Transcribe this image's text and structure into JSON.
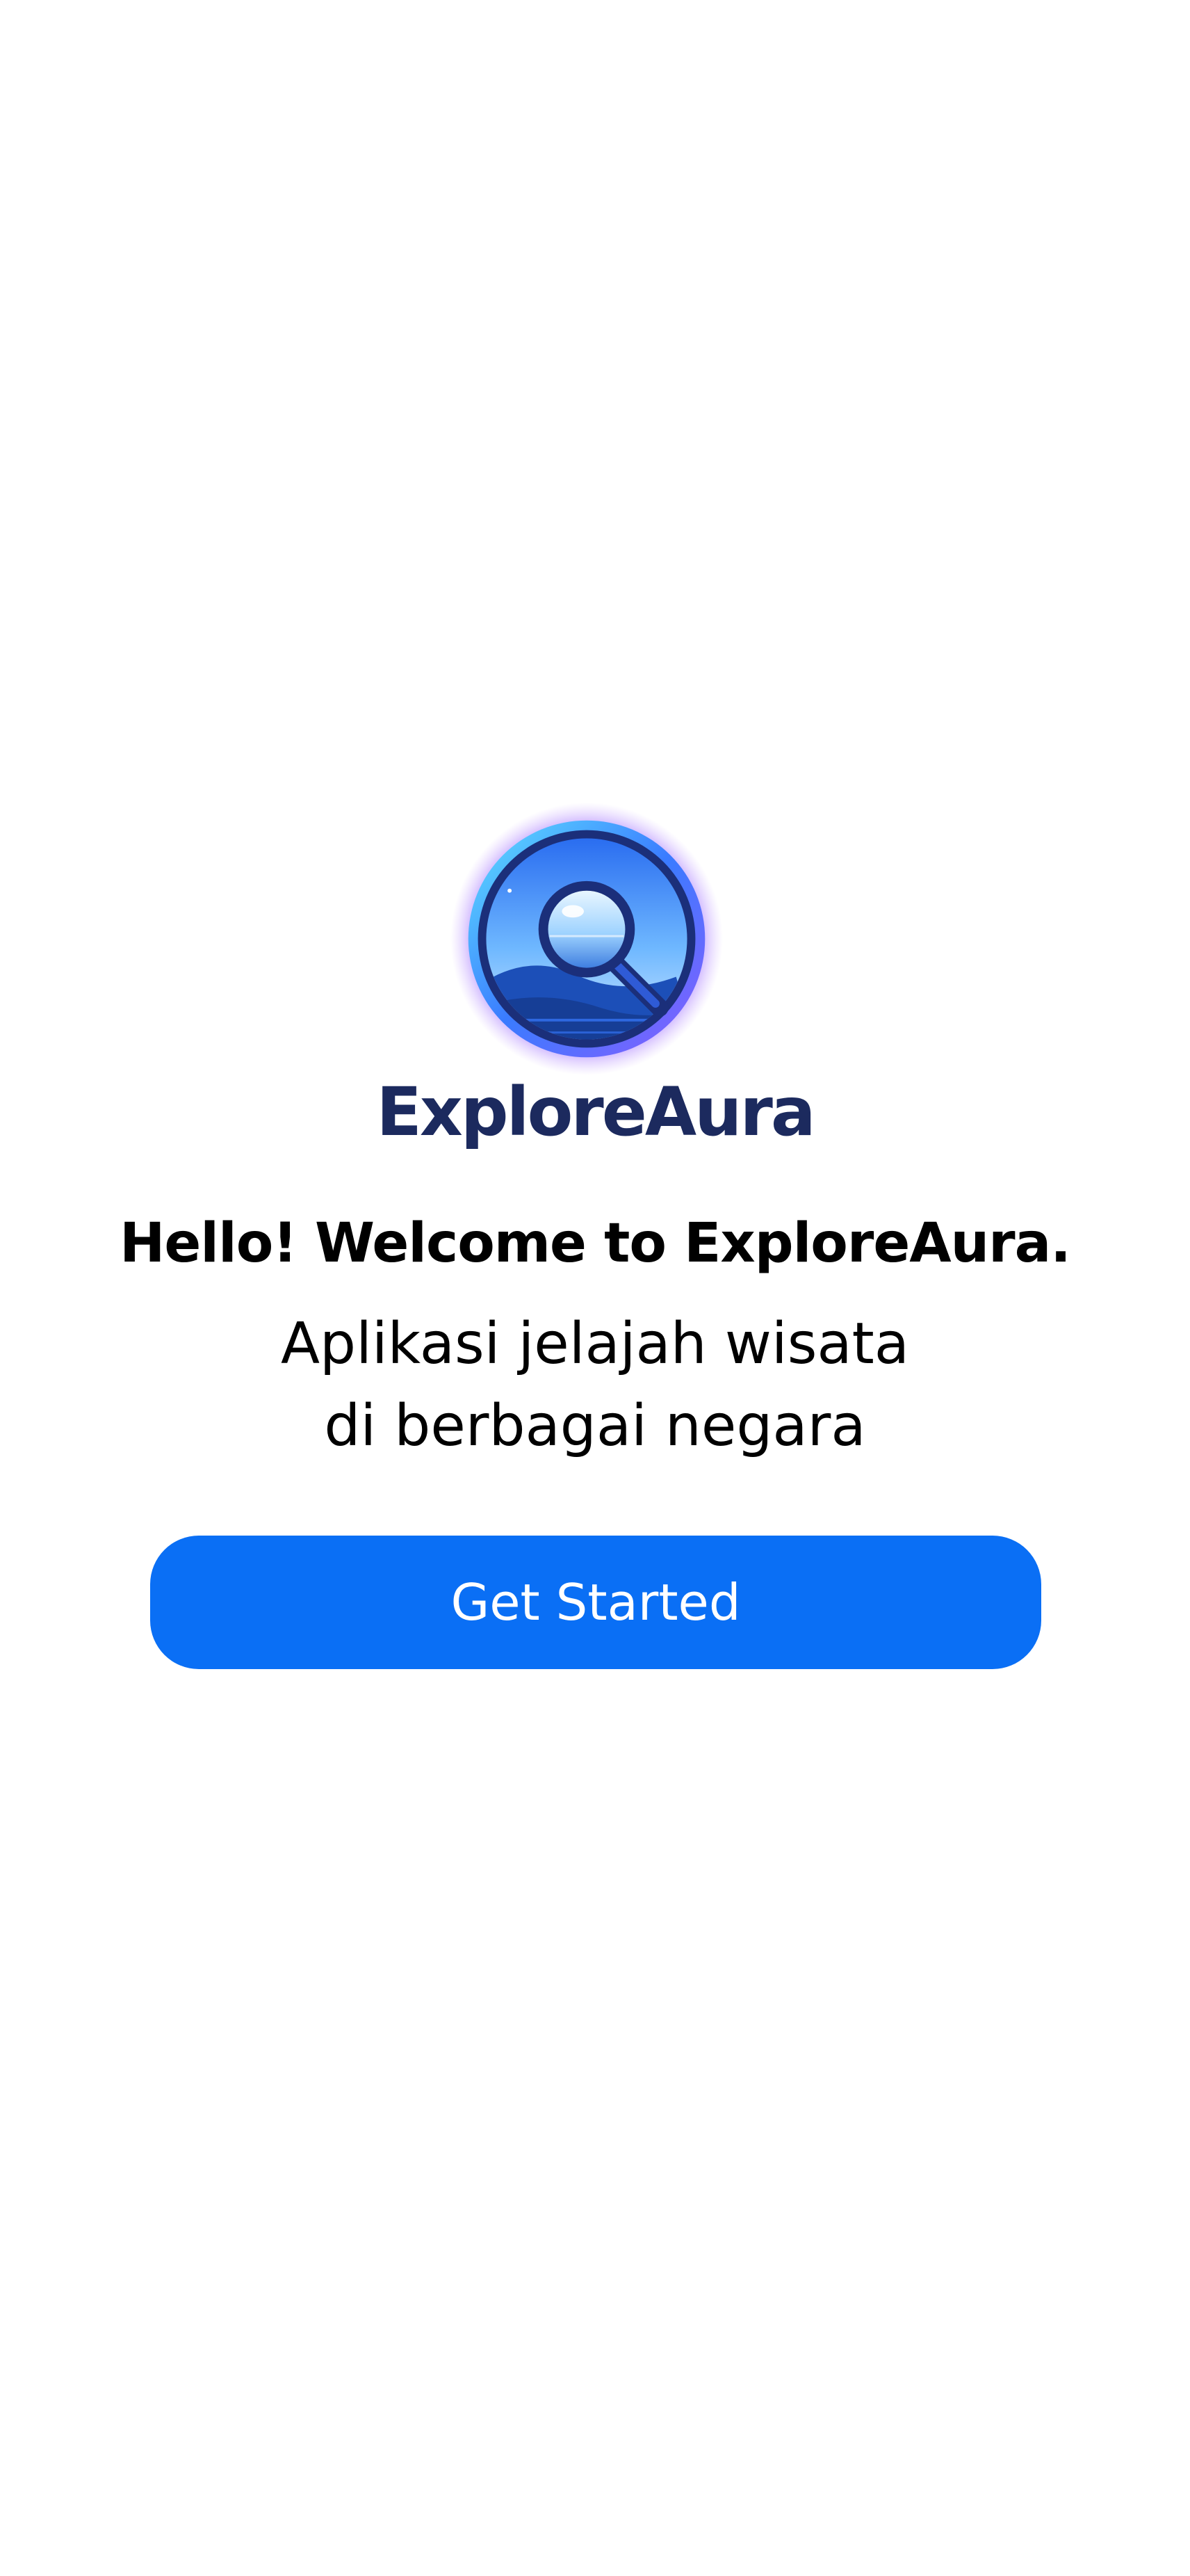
{
  "app": {
    "brand_name": "ExploreAura"
  },
  "welcome": {
    "headline": "Hello! Welcome to ExploreAura.",
    "subtitle_line1": "Aplikasi jelajah wisata",
    "subtitle_line2": "di berbagai negara"
  },
  "actions": {
    "get_started_label": "Get Started"
  },
  "icons": {
    "logo": "magnifier-over-landscape-logo-icon"
  },
  "colors": {
    "background": "#ffffff",
    "brand_text": "#1c2a5e",
    "primary_button": "#0a6ff5",
    "button_text": "#ffffff",
    "body_text": "#000000"
  }
}
